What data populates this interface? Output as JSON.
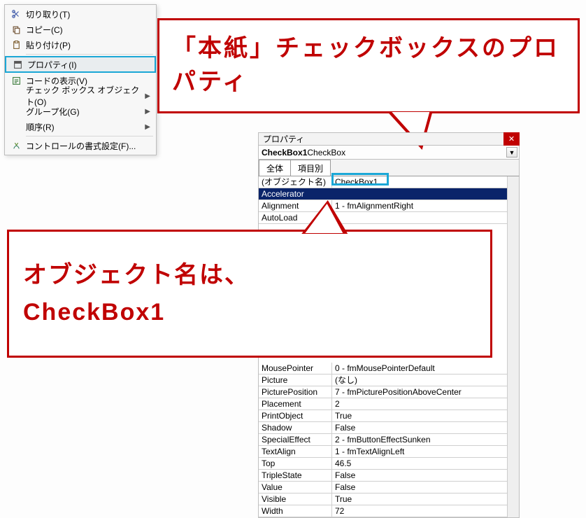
{
  "context_menu": {
    "items": [
      {
        "label": "切り取り(T)"
      },
      {
        "label": "コピー(C)"
      },
      {
        "label": "貼り付け(P)"
      },
      {
        "label": "プロパティ(I)"
      },
      {
        "label": "コードの表示(V)"
      },
      {
        "label": "チェック ボックス オブジェクト(O)"
      },
      {
        "label": "グループ化(G)"
      },
      {
        "label": "順序(R)"
      },
      {
        "label": "コントロールの書式設定(F)..."
      }
    ]
  },
  "callout1": {
    "text": "「本紙」チェックボックスのプロパティ"
  },
  "callout2": {
    "text": "オブジェクト名は、\nCheckBox1"
  },
  "prop_window": {
    "title": "プロパティ",
    "object_selector_bold": "CheckBox1",
    "object_selector_rest": " CheckBox",
    "tabs": {
      "all": "全体",
      "byitem": "項目別"
    },
    "rows": [
      {
        "k": "(オブジェクト名)",
        "v": "CheckBox1"
      },
      {
        "k": "Accelerator",
        "v": ""
      },
      {
        "k": "Alignment",
        "v": "1 - fmAlignmentRight"
      },
      {
        "k": "AutoLoad",
        "v": ""
      },
      {
        "k": "MousePointer",
        "v": "0 - fmMousePointerDefault"
      },
      {
        "k": "Picture",
        "v": "(なし)"
      },
      {
        "k": "PicturePosition",
        "v": "7 - fmPicturePositionAboveCenter"
      },
      {
        "k": "Placement",
        "v": "2"
      },
      {
        "k": "PrintObject",
        "v": "True"
      },
      {
        "k": "Shadow",
        "v": "False"
      },
      {
        "k": "SpecialEffect",
        "v": "2 - fmButtonEffectSunken"
      },
      {
        "k": "TextAlign",
        "v": "1 - fmTextAlignLeft"
      },
      {
        "k": "Top",
        "v": "46.5"
      },
      {
        "k": "TripleState",
        "v": "False"
      },
      {
        "k": "Value",
        "v": "False"
      },
      {
        "k": "Visible",
        "v": "True"
      },
      {
        "k": "Width",
        "v": "72"
      }
    ]
  }
}
